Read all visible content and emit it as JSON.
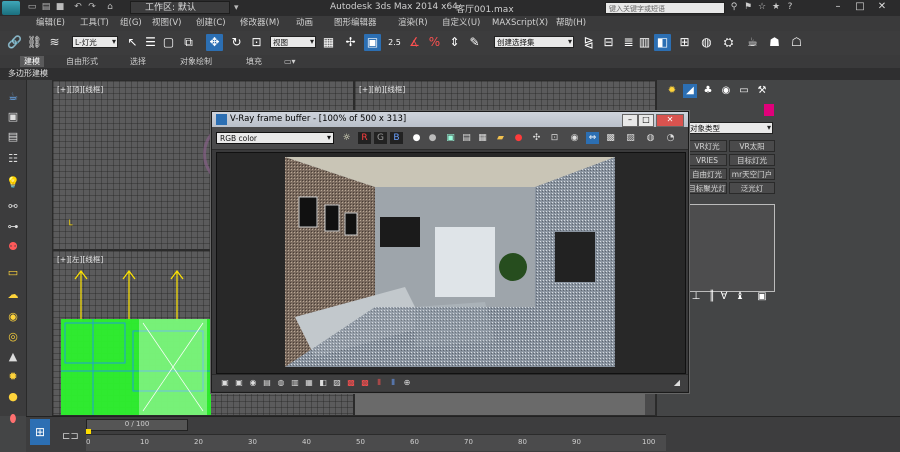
{
  "titlebar": {
    "workspace": "工作区: 默认",
    "app_title": "Autodesk 3ds Max  2014 x64",
    "file_title": "客厅001.max",
    "search_placeholder": "键入关键字或短语"
  },
  "menubar": {
    "items": [
      "编辑(E)",
      "工具(T)",
      "组(G)",
      "视图(V)",
      "创建(C)",
      "修改器(M)",
      "动画",
      "图形编辑器",
      "渲染(R)",
      "自定义(U)",
      "MAXScript(X)",
      "帮助(H)"
    ]
  },
  "toolbar": {
    "selection_filter": "L-灯光",
    "reference_coord": "视图",
    "named_selection": "创建选择集",
    "snap_label": "2.5"
  },
  "ribbon": {
    "tabs": [
      "建模",
      "自由形式",
      "选择",
      "对象绘制",
      "填充"
    ],
    "sub_label": "多边形建模"
  },
  "viewports": {
    "top_left": "[+][顶][线框]",
    "top_right": "[+][前][线框]",
    "bottom_left": "[+][左][线框]"
  },
  "vray": {
    "title": "V-Ray frame buffer - [100% of 500 x 313]",
    "channel": "RGB color",
    "r_label": "R",
    "g_label": "G",
    "b_label": "B"
  },
  "command_panel": {
    "category": "对象类型",
    "buttons": [
      "VR灯光",
      "VR太阳",
      "VRIES",
      "目标灯光",
      "自由灯光",
      "mr天空门户",
      "目标聚光灯",
      "泛光灯"
    ]
  },
  "timeline": {
    "frame": "0 / 100",
    "ticks": [
      "0",
      "10",
      "20",
      "30",
      "40",
      "50",
      "60",
      "70",
      "80",
      "90",
      "100"
    ]
  },
  "colors": {
    "accent_blue": "#2c6fb3",
    "color_swatch": "#e0007a",
    "viewport_bg": "#5b5b5c",
    "green_geometry": "#2df22d"
  }
}
